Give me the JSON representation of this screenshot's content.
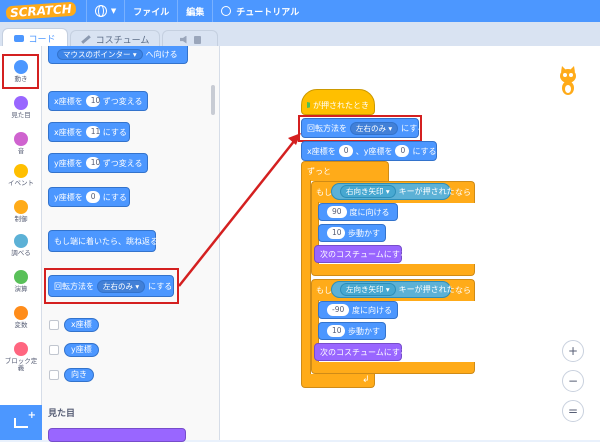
{
  "menubar": {
    "logo": "SCRATCH",
    "file": "ファイル",
    "edit": "編集",
    "tutorial": "チュートリアル"
  },
  "tabs": {
    "code": "コード",
    "costume": "コスチューム"
  },
  "categories": [
    {
      "label": "動き",
      "color": "#4c97ff"
    },
    {
      "label": "見た目",
      "color": "#9966ff"
    },
    {
      "label": "音",
      "color": "#cf63cf"
    },
    {
      "label": "イベント",
      "color": "#ffbf00"
    },
    {
      "label": "制御",
      "color": "#ffab19"
    },
    {
      "label": "調べる",
      "color": "#5cb1d6"
    },
    {
      "label": "演算",
      "color": "#59c059"
    },
    {
      "label": "変数",
      "color": "#ff8c1a"
    },
    {
      "label": "ブロック定義",
      "color": "#ff6680"
    }
  ],
  "palette": {
    "top_block": {
      "text": "マウスのポインター",
      "tail": "へ向ける"
    },
    "change_x": {
      "pre": "x座標を",
      "value": "10",
      "post": "ずつ変える"
    },
    "set_x": {
      "pre": "x座標を",
      "value": "11",
      "post": "にする"
    },
    "change_y": {
      "pre": "y座標を",
      "value": "10",
      "post": "ずつ変える"
    },
    "set_y": {
      "pre": "y座標を",
      "value": "0",
      "post": "にする"
    },
    "bounce": "もし端に着いたら、跳ね返る",
    "rotation": {
      "pre": "回転方法を",
      "value": "左右のみ",
      "post": "にする"
    },
    "reporters": [
      "x座標",
      "y座標",
      "向き"
    ],
    "section": "見た目"
  },
  "script": {
    "hat": "が押されたとき",
    "rotation": {
      "pre": "回転方法を",
      "value": "左右のみ",
      "post": "にする"
    },
    "goto": {
      "pre": "x座標を",
      "x": "0",
      "mid": "、y座標を",
      "y": "0",
      "post": "にする"
    },
    "forever": "ずっと",
    "if1": {
      "pre": "もし",
      "key": "右向き矢印",
      "mid": "キーが押された",
      "post": "なら"
    },
    "point1": {
      "value": "90",
      "post": "度に向ける"
    },
    "move1": {
      "value": "10",
      "post": "歩動かす"
    },
    "next1": "次のコスチュームにする",
    "if2": {
      "pre": "もし",
      "key": "左向き矢印",
      "mid": "キーが押された",
      "post": "なら"
    },
    "point2": {
      "value": "-90",
      "post": "度に向ける"
    },
    "move2": {
      "value": "10",
      "post": "歩動かす"
    },
    "next2": "次のコスチュームにする"
  },
  "zoom": {
    "in": "+",
    "out": "−",
    "reset": "="
  }
}
